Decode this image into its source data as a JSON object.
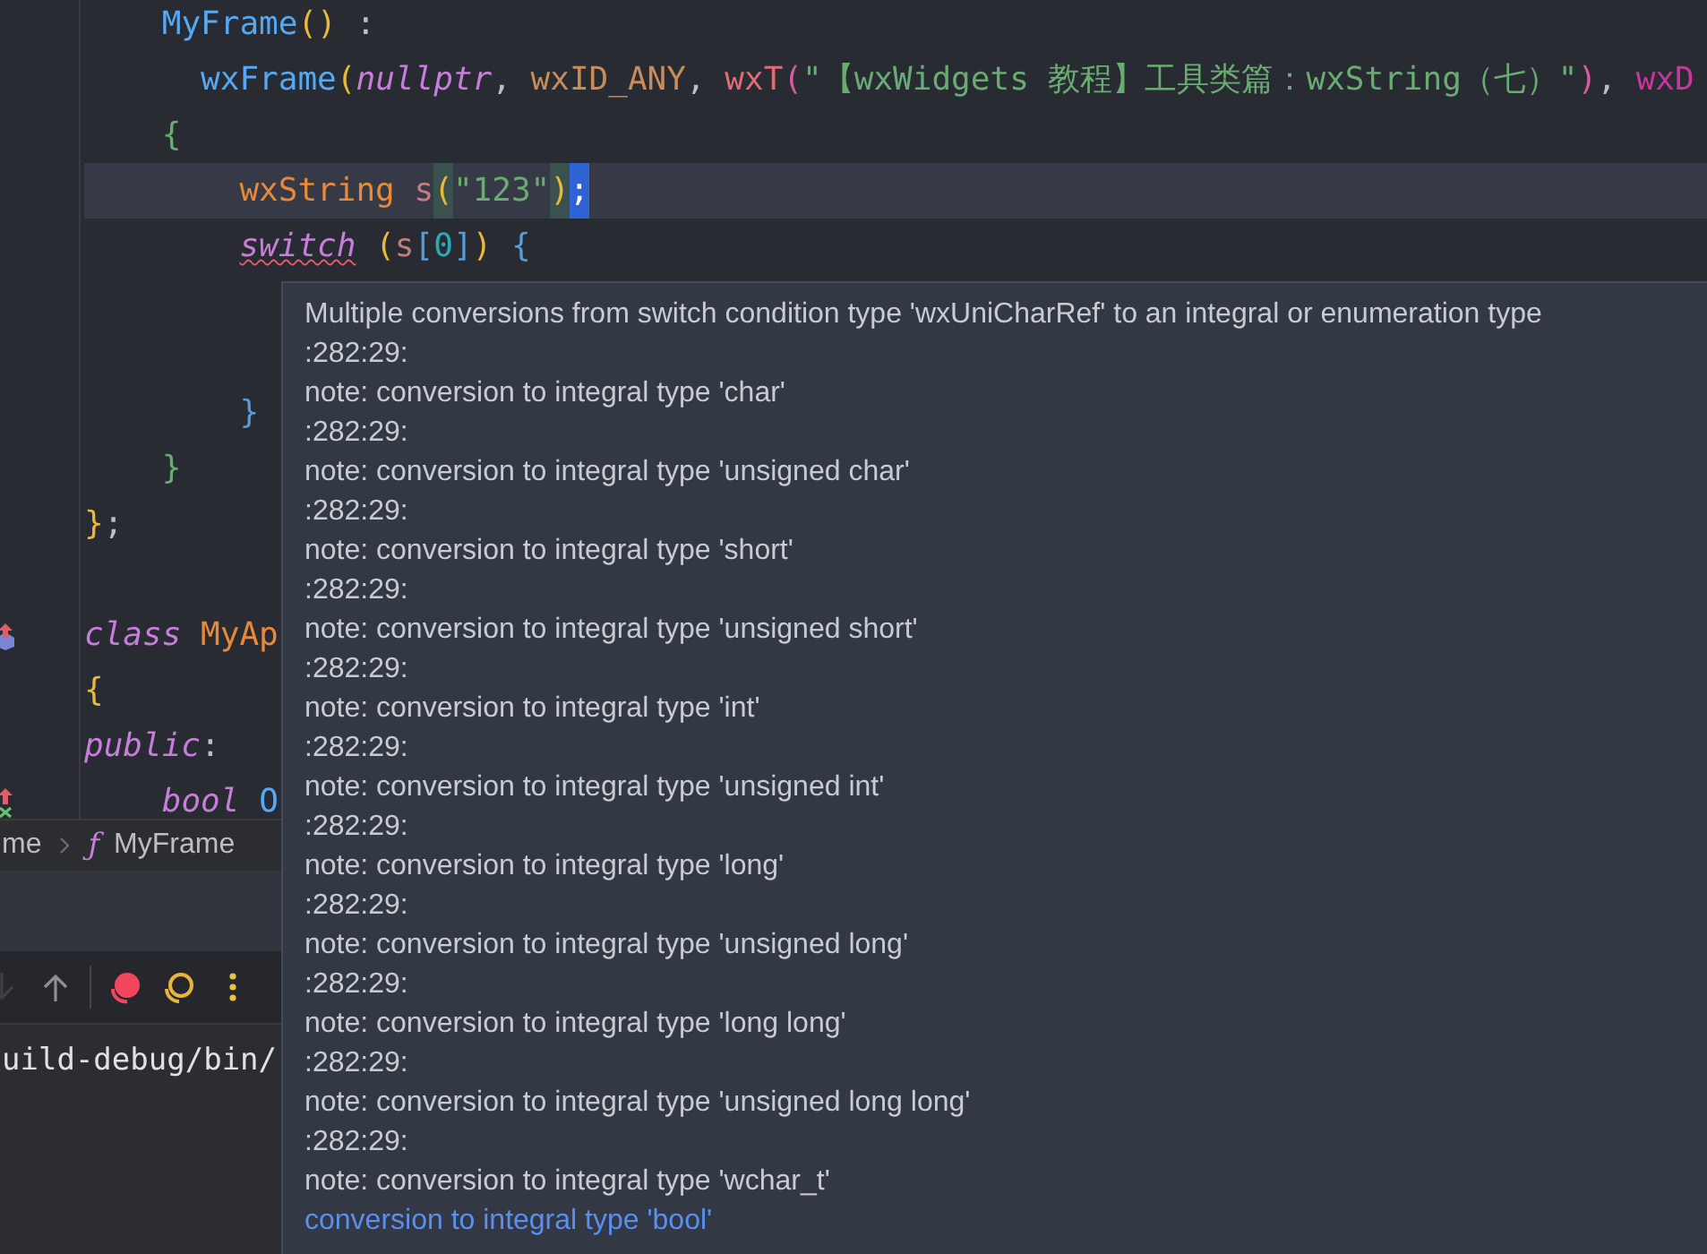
{
  "editor": {
    "lines": [
      {
        "kind": "plain",
        "current": false,
        "tokens": [
          {
            "text": "    MyFrame",
            "kind": "function"
          },
          {
            "text": "()",
            "kind": "bracket1"
          },
          {
            "text": " :",
            "kind": "punct"
          }
        ]
      },
      {
        "kind": "plain",
        "current": false,
        "tokens": [
          {
            "text": "      wxFrame",
            "kind": "function"
          },
          {
            "text": "(",
            "kind": "bracket1"
          },
          {
            "text": "nullptr",
            "kind": "keyword"
          },
          {
            "text": ",",
            "kind": "punct"
          },
          {
            "text": " wxID_ANY",
            "kind": "macro"
          },
          {
            "text": ",",
            "kind": "punct"
          },
          {
            "text": " wxT",
            "kind": "macro2"
          },
          {
            "text": "(",
            "kind": "bracket2"
          },
          {
            "text": "\"【wxWidgets 教程】工具类篇：wxString（七）\"",
            "kind": "string"
          },
          {
            "text": ")",
            "kind": "bracket2"
          },
          {
            "text": ",",
            "kind": "punct"
          },
          {
            "text": " wxD",
            "kind": "param"
          }
        ]
      },
      {
        "kind": "plain",
        "current": false,
        "tokens": [
          {
            "text": "    {",
            "kind": "bracket3"
          }
        ]
      },
      {
        "kind": "plain",
        "current": true,
        "tokens": [
          {
            "text": "        wxString",
            "kind": "type"
          },
          {
            "text": " s",
            "kind": "variable"
          },
          {
            "text": "(",
            "kind": "bracket-match"
          },
          {
            "text": "\"123\"",
            "kind": "string"
          },
          {
            "text": ")",
            "kind": "bracket-match"
          },
          {
            "text": ";",
            "kind": "caret"
          }
        ]
      },
      {
        "kind": "plain",
        "current": false,
        "tokens": [
          {
            "text": "        switch",
            "kind": "keyword-error"
          },
          {
            "text": " (",
            "kind": "bracket1"
          },
          {
            "text": "s",
            "kind": "variable"
          },
          {
            "text": "[",
            "kind": "bracket2b"
          },
          {
            "text": "0",
            "kind": "number"
          },
          {
            "text": "]",
            "kind": "bracket2b"
          },
          {
            "text": ")",
            "kind": "bracket1"
          },
          {
            "text": " {",
            "kind": "bracket2b"
          }
        ]
      },
      {
        "kind": "plain",
        "current": false
      },
      {
        "kind": "plain",
        "current": false
      },
      {
        "kind": "plain",
        "current": false,
        "tokens": [
          {
            "text": "        }",
            "kind": "bracket2b"
          }
        ]
      },
      {
        "kind": "plain",
        "current": false,
        "tokens": [
          {
            "text": "    }",
            "kind": "bracket3"
          }
        ]
      },
      {
        "kind": "plain",
        "current": false,
        "tokens": [
          {
            "text": "}",
            "kind": "bracket1"
          },
          {
            "text": ";",
            "kind": "punct"
          }
        ]
      },
      {
        "kind": "plain",
        "current": false
      },
      {
        "kind": "implements",
        "current": false,
        "tokens": [
          {
            "text": "class",
            "kind": "keyword"
          },
          {
            "text": " MyAp",
            "kind": "type"
          }
        ]
      },
      {
        "kind": "plain",
        "current": false,
        "tokens": [
          {
            "text": "{",
            "kind": "bracket1"
          }
        ]
      },
      {
        "kind": "plain",
        "current": false,
        "tokens": [
          {
            "text": "public",
            "kind": "keyword"
          },
          {
            "text": ":",
            "kind": "punct"
          }
        ]
      },
      {
        "kind": "overrides",
        "current": false,
        "tokens": [
          {
            "text": "    bool",
            "kind": "keyword"
          },
          {
            "text": " O",
            "kind": "function"
          }
        ]
      }
    ]
  },
  "breadcrumb": {
    "items": [
      {
        "text": "me"
      },
      {
        "text": "MyFrame",
        "icon": "ƒ"
      }
    ]
  },
  "toolbar": {
    "buttons": [
      {
        "kind": "down",
        "disabled": true
      },
      {
        "kind": "up",
        "disabled": false
      },
      {
        "kind": "record",
        "disabled": false
      },
      {
        "kind": "rings",
        "disabled": false
      },
      {
        "kind": "more",
        "disabled": false
      }
    ]
  },
  "terminal": {
    "lines": [
      "uild-debug/bin/"
    ]
  },
  "tooltip": {
    "lines": [
      {
        "kind": "message",
        "text": "Multiple conversions from switch condition type 'wxUniCharRef' to an integral or enumeration type"
      },
      {
        "kind": "message",
        "text": ":282:29:"
      },
      {
        "kind": "message",
        "text": "note: conversion to integral type 'char'"
      },
      {
        "kind": "message",
        "text": ":282:29:"
      },
      {
        "kind": "message",
        "text": "note: conversion to integral type 'unsigned char'"
      },
      {
        "kind": "message",
        "text": ":282:29:"
      },
      {
        "kind": "message",
        "text": "note: conversion to integral type 'short'"
      },
      {
        "kind": "message",
        "text": ":282:29:"
      },
      {
        "kind": "message",
        "text": "note: conversion to integral type 'unsigned short'"
      },
      {
        "kind": "message",
        "text": ":282:29:"
      },
      {
        "kind": "message",
        "text": "note: conversion to integral type 'int'"
      },
      {
        "kind": "message",
        "text": ":282:29:"
      },
      {
        "kind": "message",
        "text": "note: conversion to integral type 'unsigned int'"
      },
      {
        "kind": "message",
        "text": ":282:29:"
      },
      {
        "kind": "message",
        "text": "note: conversion to integral type 'long'"
      },
      {
        "kind": "message",
        "text": ":282:29:"
      },
      {
        "kind": "message",
        "text": "note: conversion to integral type 'unsigned long'"
      },
      {
        "kind": "message",
        "text": ":282:29:"
      },
      {
        "kind": "message",
        "text": "note: conversion to integral type 'long long'"
      },
      {
        "kind": "message",
        "text": ":282:29:"
      },
      {
        "kind": "message",
        "text": "note: conversion to integral type 'unsigned long long'"
      },
      {
        "kind": "message",
        "text": ":282:29:"
      },
      {
        "kind": "message",
        "text": "note: conversion to integral type 'wchar_t'"
      },
      {
        "kind": "link",
        "text": "conversion to integral type 'bool'"
      }
    ]
  }
}
